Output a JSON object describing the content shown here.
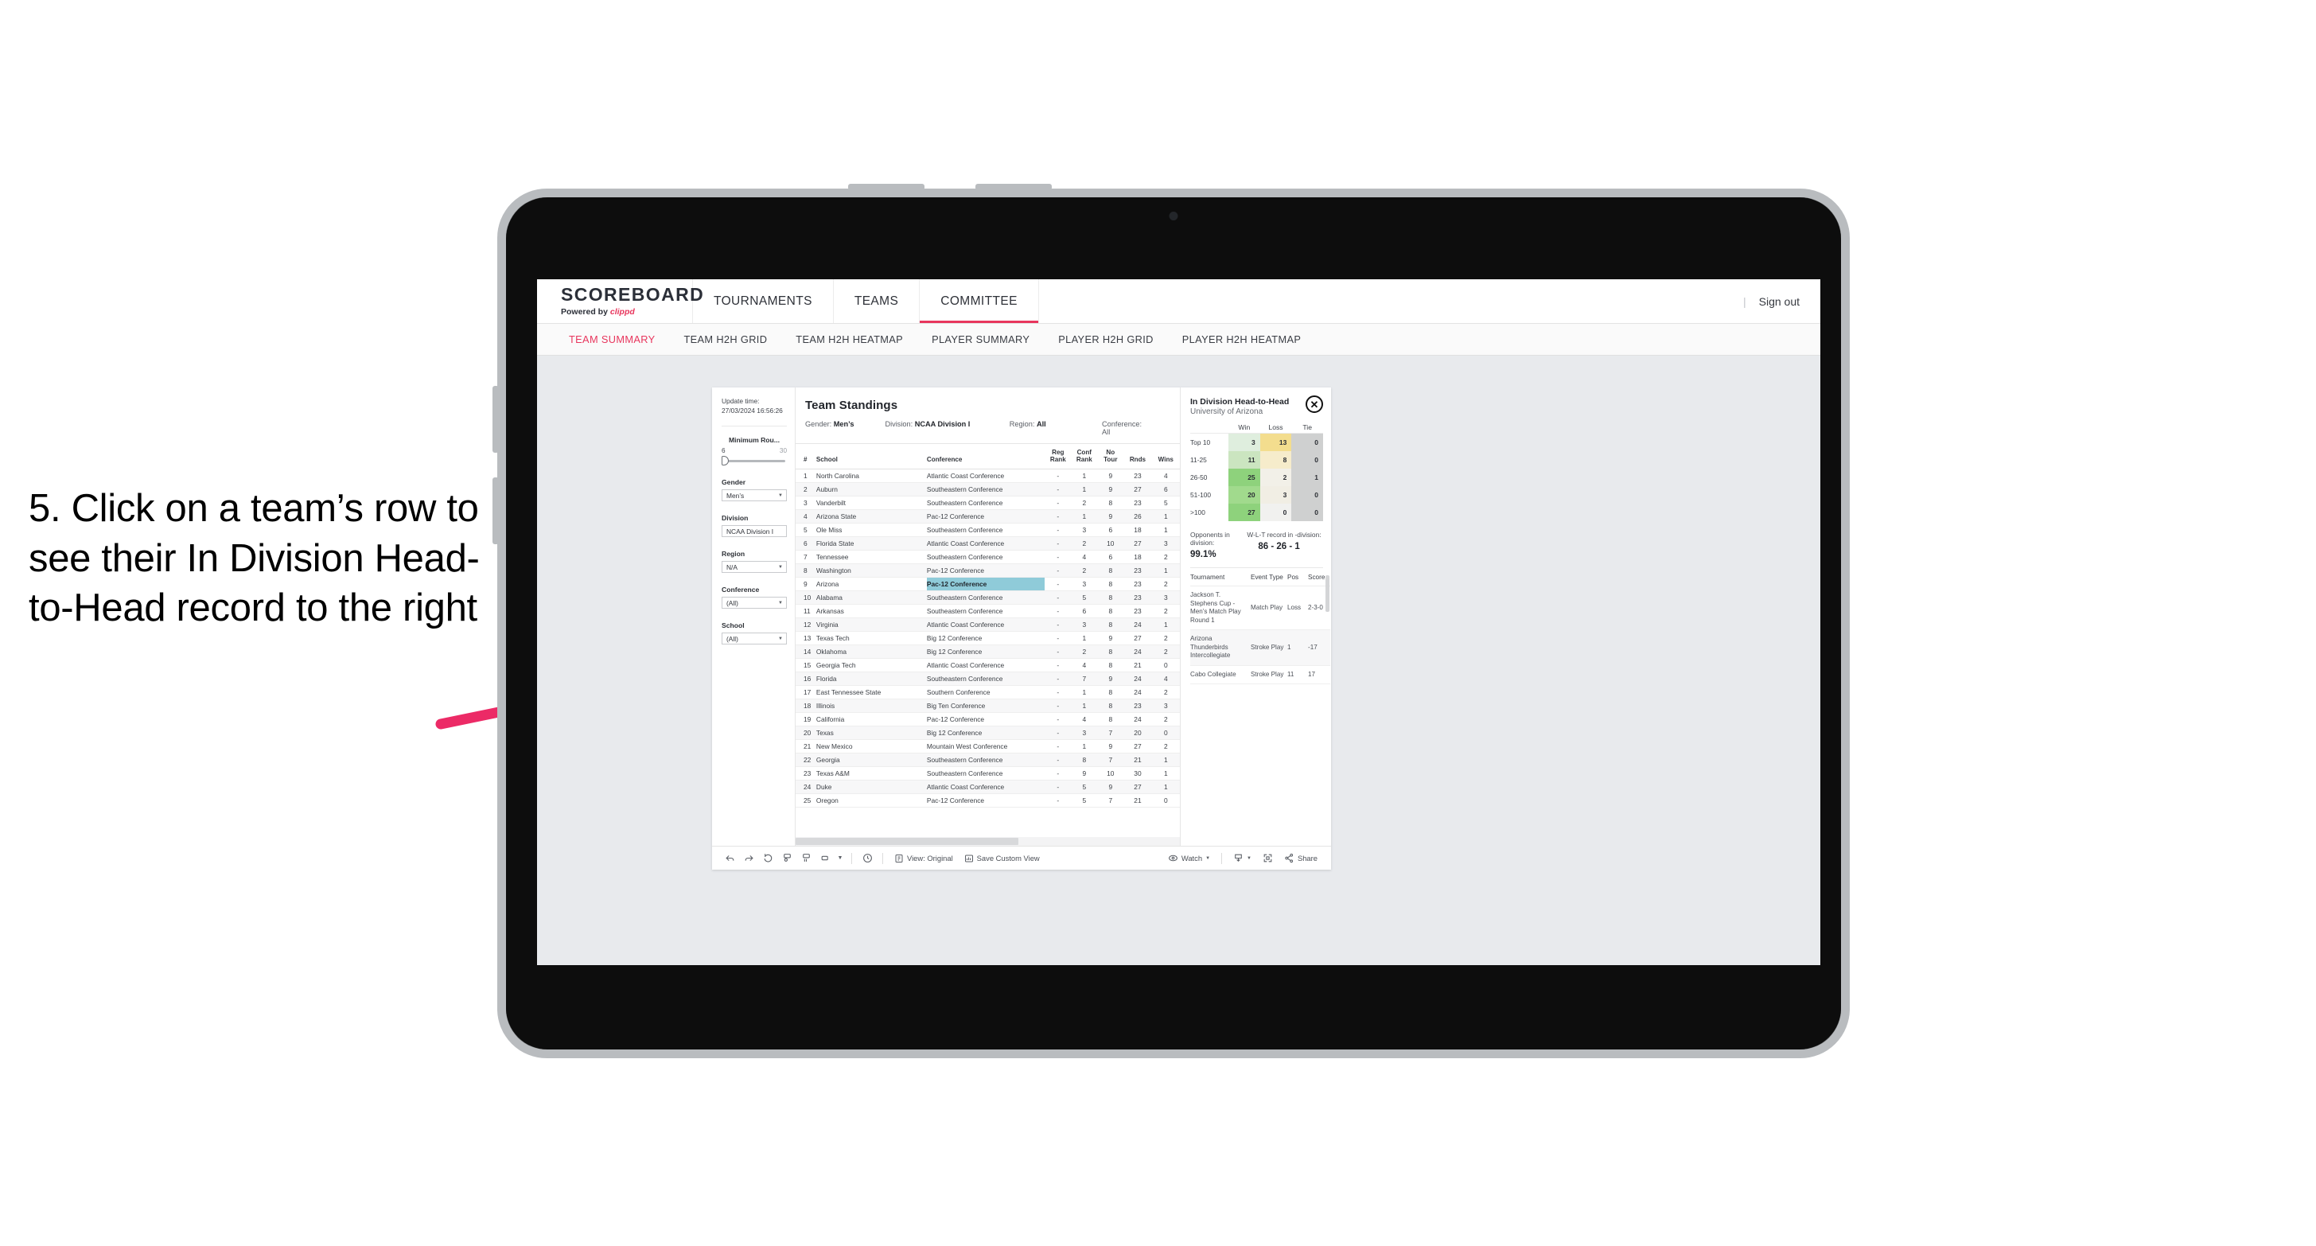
{
  "annotation": {
    "text": "5. Click on a team’s row to see their In Division Head-to-Head record to the right",
    "arrow_color": "#ec2a66"
  },
  "topnav": {
    "brand_main": "SCOREBOARD",
    "brand_sub_prefix": "Powered by ",
    "brand_sub_name": "clippd",
    "items": [
      {
        "label": "TOURNAMENTS",
        "active": false
      },
      {
        "label": "TEAMS",
        "active": false
      },
      {
        "label": "COMMITTEE",
        "active": true
      }
    ],
    "divider": "|",
    "signout": "Sign out"
  },
  "subnav": {
    "items": [
      {
        "label": "TEAM SUMMARY",
        "active": true
      },
      {
        "label": "TEAM H2H GRID",
        "active": false
      },
      {
        "label": "TEAM H2H HEATMAP",
        "active": false
      },
      {
        "label": "PLAYER SUMMARY",
        "active": false
      },
      {
        "label": "PLAYER H2H GRID",
        "active": false
      },
      {
        "label": "PLAYER H2H HEATMAP",
        "active": false
      }
    ]
  },
  "filters": {
    "update_label": "Update time:",
    "update_value": "27/03/2024 16:56:26",
    "min_rounds_label": "Minimum Rou...",
    "min_rounds_value": "6",
    "min_rounds_max": "30",
    "controls": [
      {
        "label": "Gender",
        "value": "Men’s"
      },
      {
        "label": "Division",
        "value": "NCAA Division I"
      },
      {
        "label": "Region",
        "value": "N/A"
      },
      {
        "label": "Conference",
        "value": "(All)"
      },
      {
        "label": "School",
        "value": "(All)"
      }
    ]
  },
  "standings": {
    "title": "Team Standings",
    "summary": [
      {
        "label": "Gender: ",
        "value": "Men’s"
      },
      {
        "label": "Division: ",
        "value": "NCAA Division I"
      },
      {
        "label": "Region: ",
        "value": "All"
      },
      {
        "label": "Conference: ",
        "value": "All"
      }
    ],
    "columns": [
      "#",
      "School",
      "Conference",
      "Reg Rank",
      "Conf Rank",
      "No Tour",
      "Rnds",
      "Wins"
    ],
    "rows": [
      [
        "1",
        "North Carolina",
        "Atlantic Coast Conference",
        "-",
        "1",
        "9",
        "23",
        "4"
      ],
      [
        "2",
        "Auburn",
        "Southeastern Conference",
        "-",
        "1",
        "9",
        "27",
        "6"
      ],
      [
        "3",
        "Vanderbilt",
        "Southeastern Conference",
        "-",
        "2",
        "8",
        "23",
        "5"
      ],
      [
        "4",
        "Arizona State",
        "Pac-12 Conference",
        "-",
        "1",
        "9",
        "26",
        "1"
      ],
      [
        "5",
        "Ole Miss",
        "Southeastern Conference",
        "-",
        "3",
        "6",
        "18",
        "1"
      ],
      [
        "6",
        "Florida State",
        "Atlantic Coast Conference",
        "-",
        "2",
        "10",
        "27",
        "3"
      ],
      [
        "7",
        "Tennessee",
        "Southeastern Conference",
        "-",
        "4",
        "6",
        "18",
        "2"
      ],
      [
        "8",
        "Washington",
        "Pac-12 Conference",
        "-",
        "2",
        "8",
        "23",
        "1"
      ],
      [
        "9",
        "Arizona",
        "Pac-12 Conference",
        "-",
        "3",
        "8",
        "23",
        "2"
      ],
      [
        "10",
        "Alabama",
        "Southeastern Conference",
        "-",
        "5",
        "8",
        "23",
        "3"
      ],
      [
        "11",
        "Arkansas",
        "Southeastern Conference",
        "-",
        "6",
        "8",
        "23",
        "2"
      ],
      [
        "12",
        "Virginia",
        "Atlantic Coast Conference",
        "-",
        "3",
        "8",
        "24",
        "1"
      ],
      [
        "13",
        "Texas Tech",
        "Big 12 Conference",
        "-",
        "1",
        "9",
        "27",
        "2"
      ],
      [
        "14",
        "Oklahoma",
        "Big 12 Conference",
        "-",
        "2",
        "8",
        "24",
        "2"
      ],
      [
        "15",
        "Georgia Tech",
        "Atlantic Coast Conference",
        "-",
        "4",
        "8",
        "21",
        "0"
      ],
      [
        "16",
        "Florida",
        "Southeastern Conference",
        "-",
        "7",
        "9",
        "24",
        "4"
      ],
      [
        "17",
        "East Tennessee State",
        "Southern Conference",
        "-",
        "1",
        "8",
        "24",
        "2"
      ],
      [
        "18",
        "Illinois",
        "Big Ten Conference",
        "-",
        "1",
        "8",
        "23",
        "3"
      ],
      [
        "19",
        "California",
        "Pac-12 Conference",
        "-",
        "4",
        "8",
        "24",
        "2"
      ],
      [
        "20",
        "Texas",
        "Big 12 Conference",
        "-",
        "3",
        "7",
        "20",
        "0"
      ],
      [
        "21",
        "New Mexico",
        "Mountain West Conference",
        "-",
        "1",
        "9",
        "27",
        "2"
      ],
      [
        "22",
        "Georgia",
        "Southeastern Conference",
        "-",
        "8",
        "7",
        "21",
        "1"
      ],
      [
        "23",
        "Texas A&M",
        "Southeastern Conference",
        "-",
        "9",
        "10",
        "30",
        "1"
      ],
      [
        "24",
        "Duke",
        "Atlantic Coast Conference",
        "-",
        "5",
        "9",
        "27",
        "1"
      ],
      [
        "25",
        "Oregon",
        "Pac-12 Conference",
        "-",
        "5",
        "7",
        "21",
        "0"
      ]
    ],
    "selected_row_index": 8,
    "selected_highlight_color": "#8fcbd9"
  },
  "detail": {
    "title": "In Division Head-to-Head",
    "subtitle": "University of Arizona",
    "close_icon": "✕",
    "heatmap": {
      "columns": [
        "Win",
        "Loss",
        "Tie"
      ],
      "rows": [
        {
          "label": "Top 10",
          "win": "3",
          "loss": "13",
          "tie": "0",
          "win_color": "#dfeede",
          "loss_color": "#f3dd8e",
          "tie_color": "#cfd0d0"
        },
        {
          "label": "11-25",
          "win": "11",
          "loss": "8",
          "tie": "0",
          "win_color": "#cbe5c0",
          "loss_color": "#f6eccb",
          "tie_color": "#cfd0d0"
        },
        {
          "label": "26-50",
          "win": "25",
          "loss": "2",
          "tie": "1",
          "win_color": "#8ed27c",
          "loss_color": "#f2f0e8",
          "tie_color": "#cfd0d0"
        },
        {
          "label": "51-100",
          "win": "20",
          "loss": "3",
          "tie": "0",
          "win_color": "#a1da8d",
          "loss_color": "#f1eee4",
          "tie_color": "#cfd0d0"
        },
        {
          "label": ">100",
          "win": "27",
          "loss": "0",
          "tie": "0",
          "win_color": "#8ed27c",
          "loss_color": "#f1f1ef",
          "tie_color": "#cfd0d0"
        }
      ]
    },
    "stats": [
      {
        "label": "Opponents in division:",
        "value": "99.1%"
      },
      {
        "label": "W-L-T record in -division:",
        "value": "86 - 26 - 1"
      }
    ],
    "tournaments": {
      "columns": [
        "Tournament",
        "Event Type",
        "Pos",
        "Score"
      ],
      "rows": [
        [
          "Jackson T. Stephens Cup - Men’s Match Play Round 1",
          "Match Play",
          "Loss",
          "2-3-0"
        ],
        [
          "Arizona Thunderbirds Intercollegiate",
          "Stroke Play",
          "1",
          "-17"
        ],
        [
          "Cabo Collegiate",
          "Stroke Play",
          "11",
          "17"
        ]
      ]
    }
  },
  "toolbar": {
    "view_label": "View: Original",
    "save_label": "Save Custom View",
    "watch_label": "Watch",
    "share_label": "Share"
  }
}
